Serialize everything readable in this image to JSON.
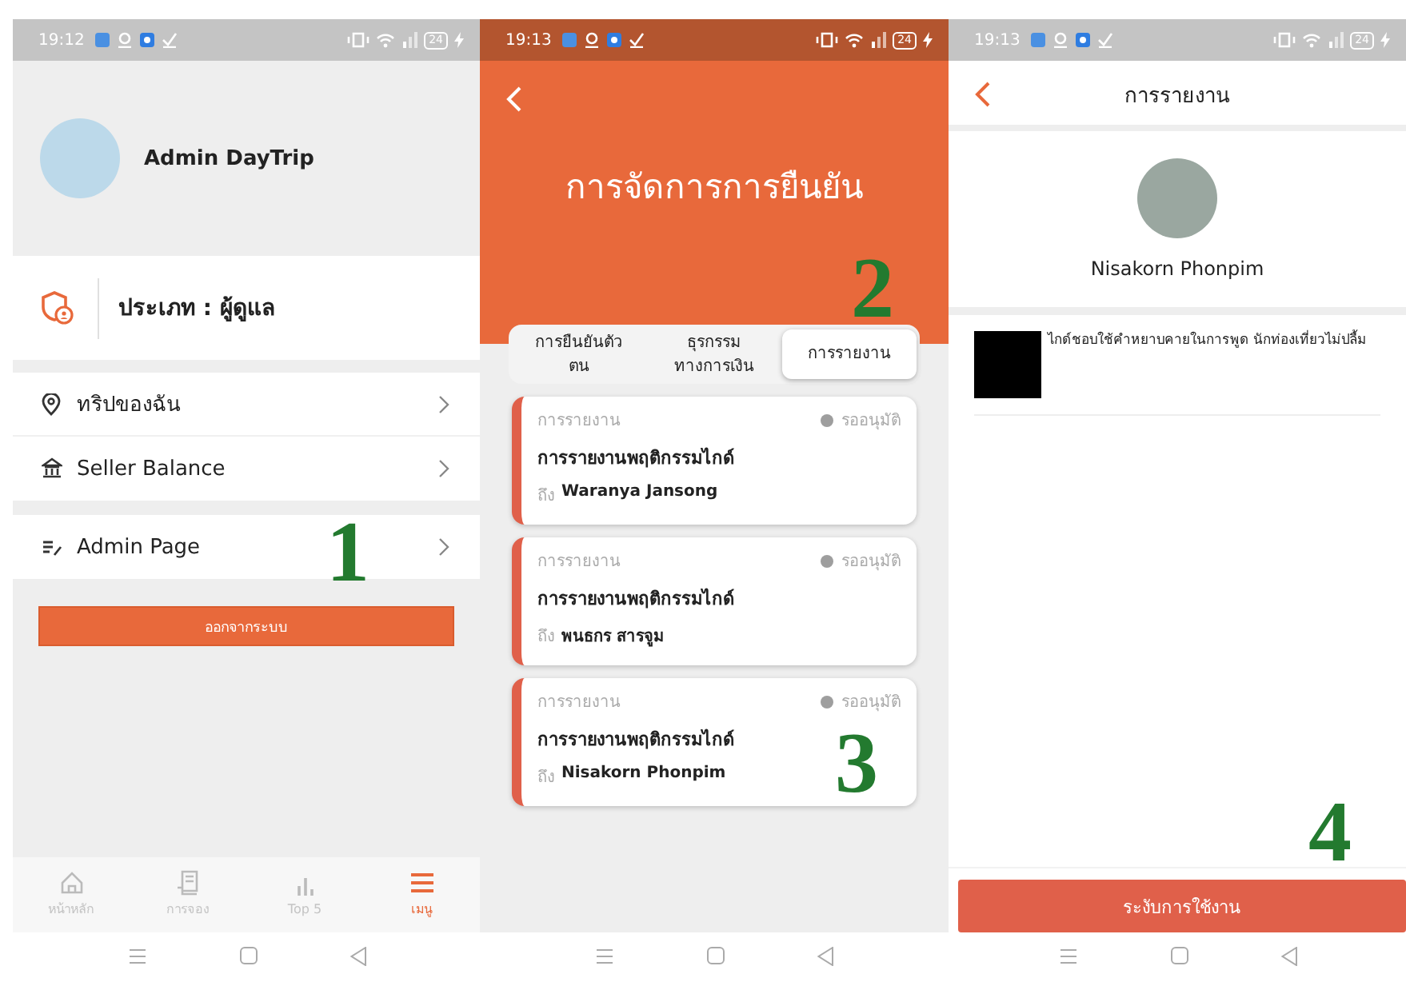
{
  "screens": [
    {
      "kind": "menu",
      "status_bar": {
        "time": "19:12",
        "battery": "24"
      },
      "profile": {
        "name": "Admin DayTrip"
      },
      "role": "ประเภท : ผู้ดูแล",
      "menu_groups": [
        [
          {
            "kind": "location",
            "label": "ทริปของฉัน"
          },
          {
            "kind": "balance",
            "label": "Seller Balance"
          }
        ],
        [
          {
            "kind": "admin",
            "label": "Admin Page",
            "marker": "1"
          }
        ]
      ],
      "logout_button": "ออกจากระบบ",
      "tab_bar": [
        {
          "kind": "home",
          "label": "หน้าหลัก",
          "selected": false
        },
        {
          "kind": "booking",
          "label": "การจอง",
          "selected": false
        },
        {
          "kind": "chart",
          "label": "Top 5",
          "selected": false
        },
        {
          "kind": "menu",
          "label": "เมนู",
          "selected": true
        }
      ]
    },
    {
      "kind": "approvals",
      "status_bar": {
        "time": "19:13",
        "battery": "24"
      },
      "title": "การจัดการการยืนยัน",
      "tabs": [
        {
          "label": "การยืนยันตัว\nตน",
          "selected": false
        },
        {
          "label": "ธุรกรรม\nทางการเงิน",
          "selected": false
        },
        {
          "label": "การรายงาน",
          "selected": true
        }
      ],
      "tabs_marker": "2",
      "cards": [
        {
          "category": "การรายงาน",
          "status": "รออนุมัติ",
          "title": "การรายงานพฤติกรรมไกด์",
          "to_label": "ถึง",
          "to_name": "Waranya Jansong"
        },
        {
          "category": "การรายงาน",
          "status": "รออนุมัติ",
          "title": "การรายงานพฤติกรรมไกด์",
          "to_label": "ถึง",
          "to_name": "พนธกร สารจูม"
        },
        {
          "category": "การรายงาน",
          "status": "รออนุมัติ",
          "title": "การรายงานพฤติกรรมไกด์",
          "to_label": "ถึง",
          "to_name": "Nisakorn Phonpim",
          "marker": "3"
        }
      ]
    },
    {
      "kind": "report",
      "status_bar": {
        "time": "19:13",
        "battery": "24"
      },
      "title": "การรายงาน",
      "profile": {
        "name": "Nisakorn Phonpim"
      },
      "reports": [
        {
          "text": "ไกด์ชอบใช้คำหยาบคายในการพูด นักท่องเที่ยวไม่ปลื้ม"
        }
      ],
      "action_button": "ระงับการใช้งาน",
      "button_marker": "4"
    }
  ]
}
